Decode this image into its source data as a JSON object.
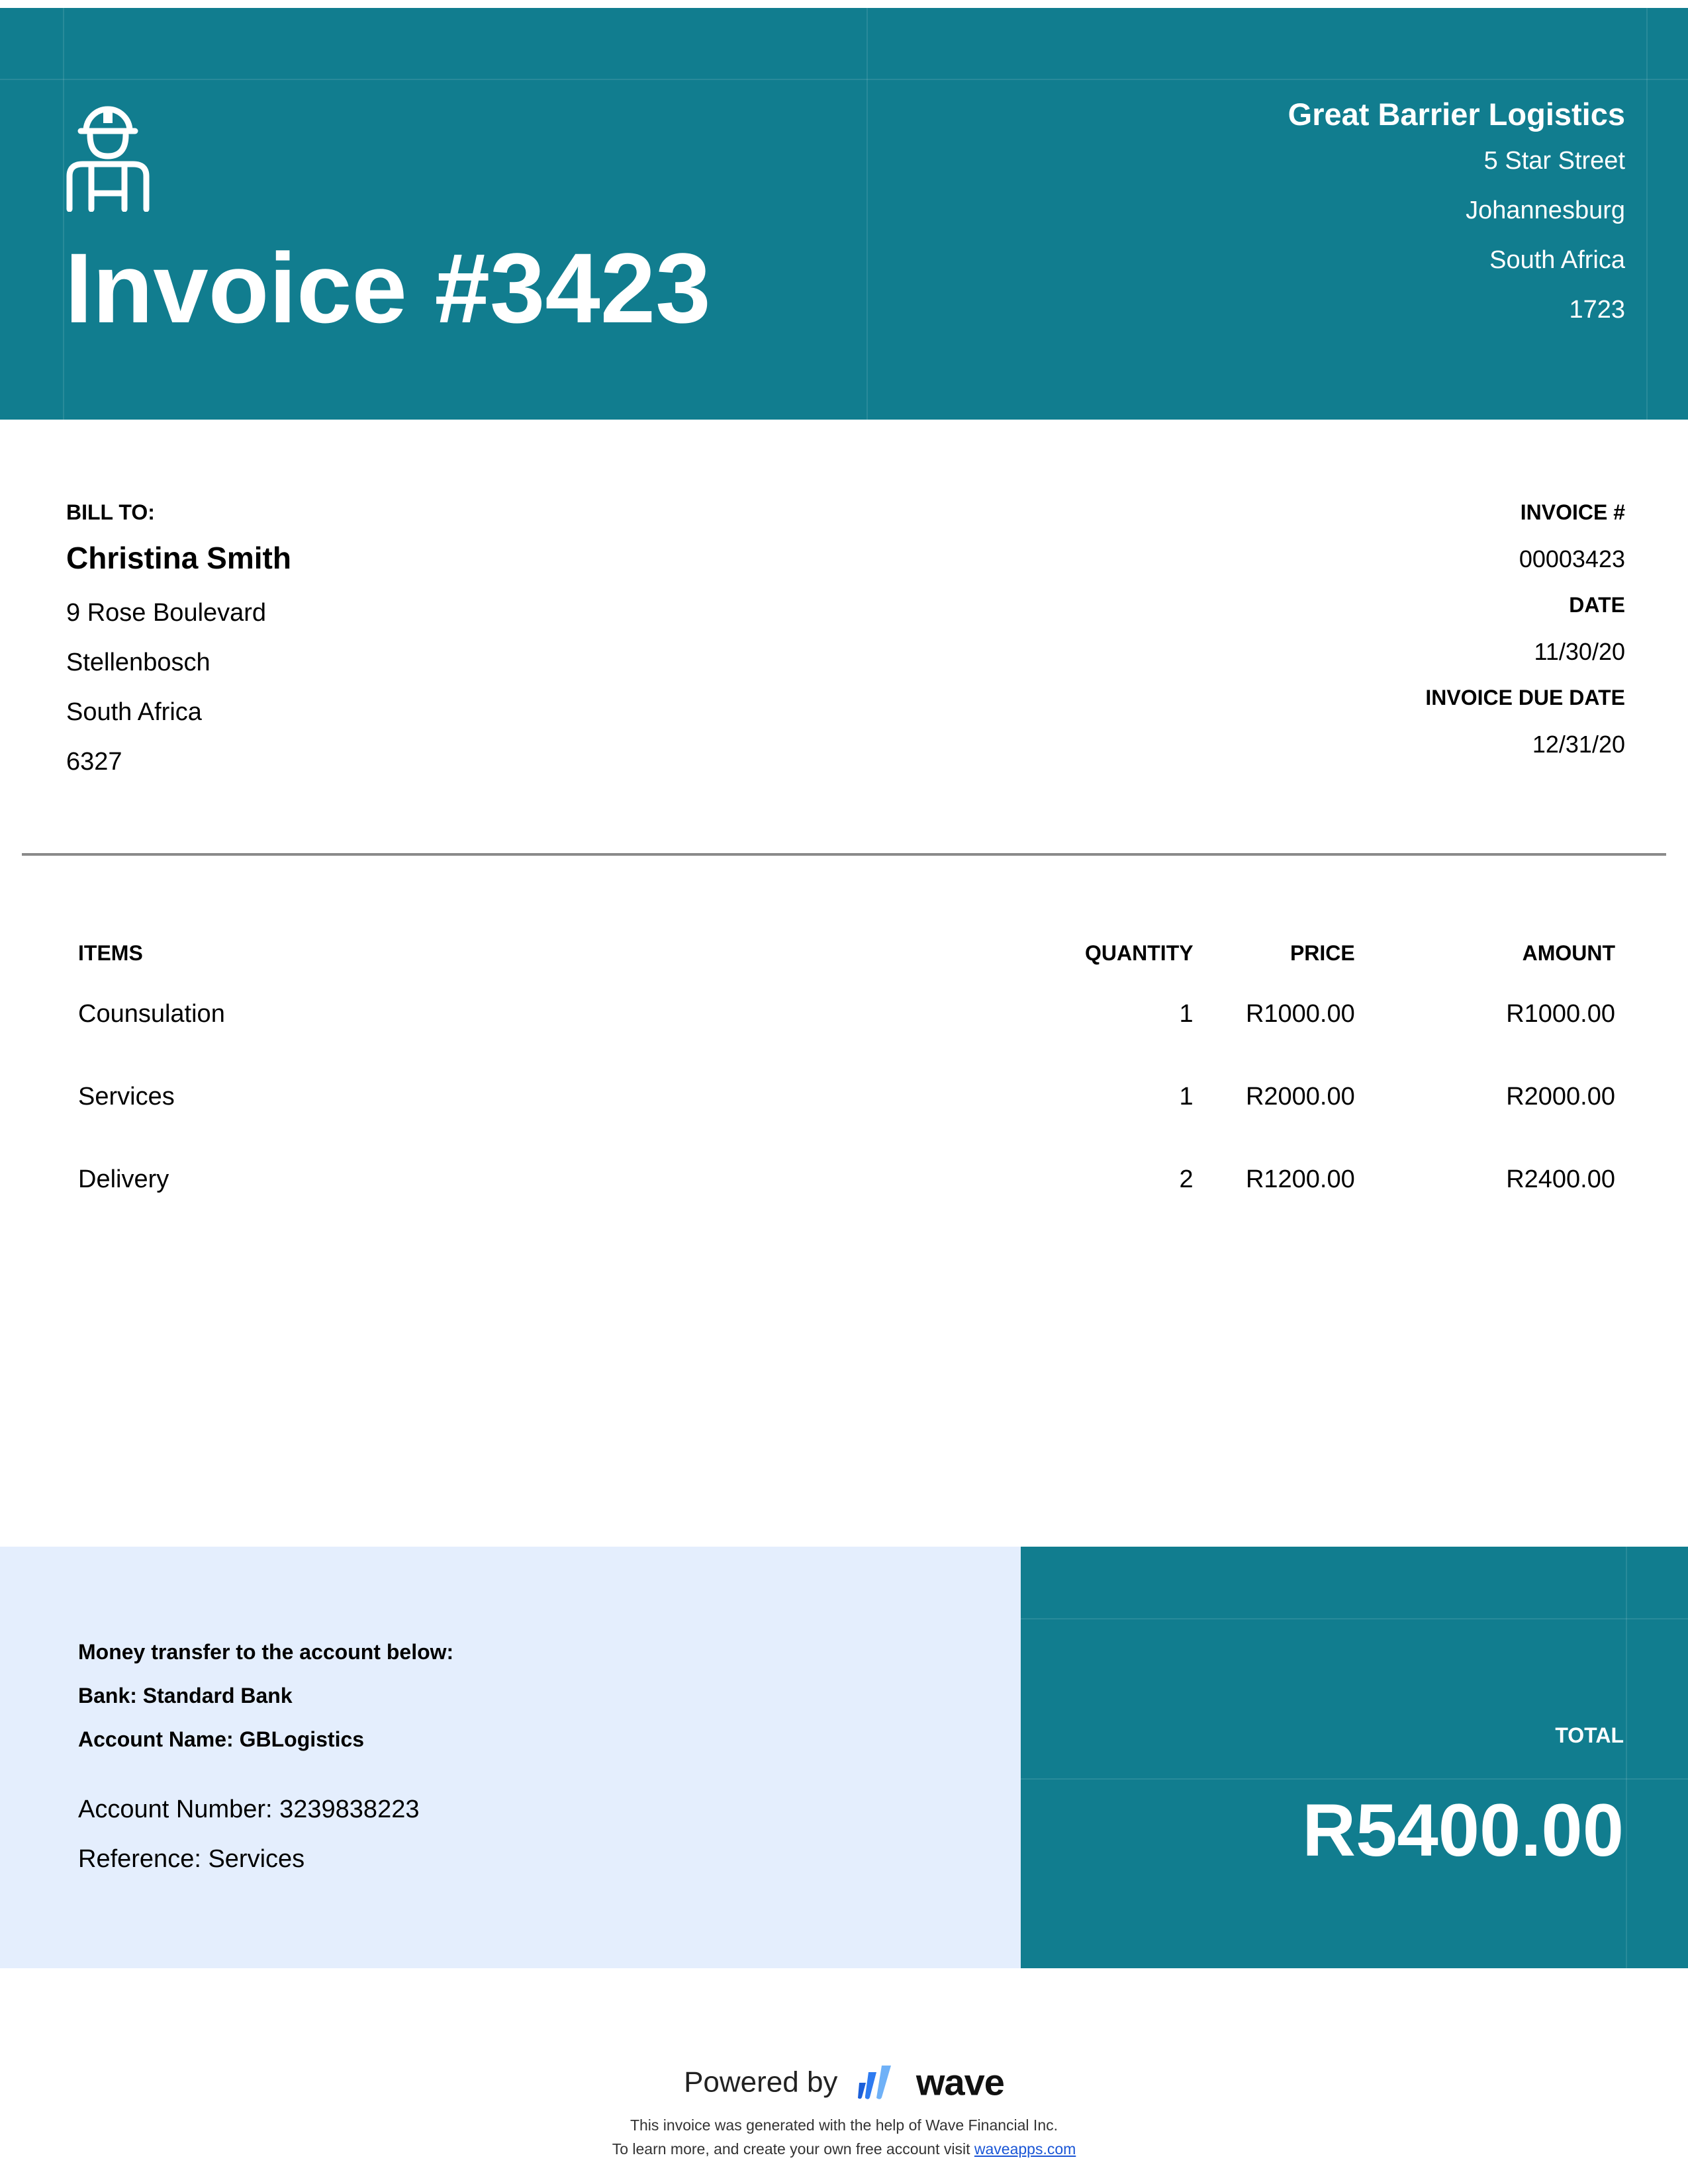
{
  "colors": {
    "brand": "#117d8f",
    "payment_bg": "#e4eefd",
    "divider": "#8a8a8a"
  },
  "header": {
    "icon": "construction-worker-icon",
    "title": "Invoice #3423",
    "company": {
      "name": "Great Barrier Logistics",
      "street": "5 Star Street",
      "city": "Johannesburg",
      "country": "South Africa",
      "postal": "1723"
    }
  },
  "bill_to": {
    "label": "BILL TO:",
    "name": "Christina Smith",
    "street": "9 Rose Boulevard",
    "city": "Stellenbosch",
    "country": "South Africa",
    "postal": "6327"
  },
  "meta": {
    "invoice_label": "INVOICE #",
    "invoice_number": "00003423",
    "date_label": "DATE",
    "date": "11/30/20",
    "due_label": "INVOICE DUE DATE",
    "due_date": "12/31/20"
  },
  "items": {
    "headers": {
      "item": "ITEMS",
      "quantity": "QUANTITY",
      "price": "PRICE",
      "amount": "AMOUNT"
    },
    "rows": [
      {
        "item": "Counsulation",
        "quantity": "1",
        "price": "R1000.00",
        "amount": "R1000.00"
      },
      {
        "item": "Services",
        "quantity": "1",
        "price": "R2000.00",
        "amount": "R2000.00"
      },
      {
        "item": "Delivery",
        "quantity": "2",
        "price": "R1200.00",
        "amount": "R2400.00"
      }
    ]
  },
  "payment": {
    "intro": "Money transfer to the account below:",
    "bank": "Bank: Standard Bank",
    "account_name": "Account Name: GBLogistics",
    "account_number": "Account Number: 3239838223",
    "reference": "Reference: Services"
  },
  "total": {
    "label": "TOTAL",
    "value": "R5400.00"
  },
  "footer": {
    "powered_by": "Powered by",
    "logo_icon": "wave-logo-icon",
    "brand": "wave",
    "line1": "This invoice was generated with the help of Wave Financial Inc.",
    "line2": "To learn more, and create your own free account visit",
    "link": "waveapps.com"
  }
}
